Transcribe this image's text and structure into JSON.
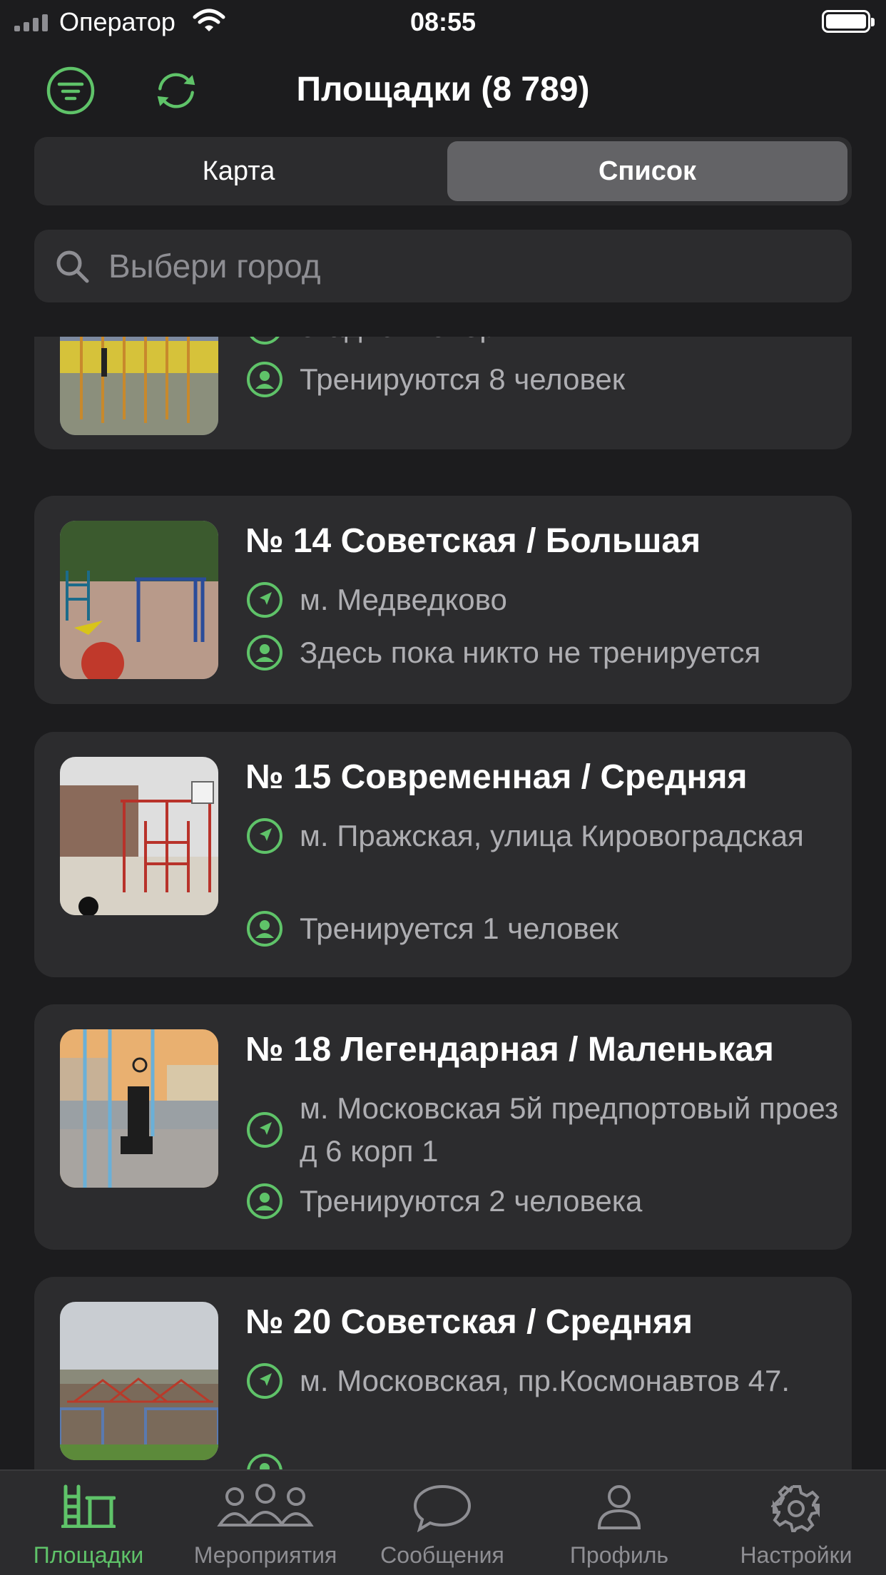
{
  "status_bar": {
    "carrier": "Оператор",
    "time": "08:55"
  },
  "header": {
    "title": "Площадки (8 789)",
    "filter_icon": "filter-icon",
    "refresh_icon": "refresh-icon"
  },
  "segmented": {
    "map": "Карта",
    "list": "Список",
    "selected": "Список"
  },
  "search": {
    "placeholder": "Выбери город",
    "value": ""
  },
  "accent_color": "#5fc369",
  "parks": [
    {
      "title": "",
      "location": "стадион \"энергия\"",
      "people": "Тренируются 8 человек"
    },
    {
      "title": "№ 14 Советская / Большая",
      "location": "м. Медведково",
      "people": "Здесь пока никто не тренируется"
    },
    {
      "title": "№ 15 Современная / Средняя",
      "location": "м. Пражская, улица Кировоградская",
      "people": "Тренируется 1 человек"
    },
    {
      "title": "№ 18 Легендарная / Маленькая",
      "location": "м. Московская 5й предпортовый проез д 6 корп 1",
      "people": "Тренируются 2 человека"
    },
    {
      "title": "№ 20 Советская / Средняя",
      "location": "м. Московская, пр.Космонавтов 47.",
      "people": ""
    }
  ],
  "tabs": [
    {
      "label": "Площадки",
      "icon": "parks-icon",
      "active": true
    },
    {
      "label": "Мероприятия",
      "icon": "events-icon",
      "active": false
    },
    {
      "label": "Сообщения",
      "icon": "messages-icon",
      "active": false
    },
    {
      "label": "Профиль",
      "icon": "profile-icon",
      "active": false
    },
    {
      "label": "Настройки",
      "icon": "settings-icon",
      "active": false
    }
  ]
}
